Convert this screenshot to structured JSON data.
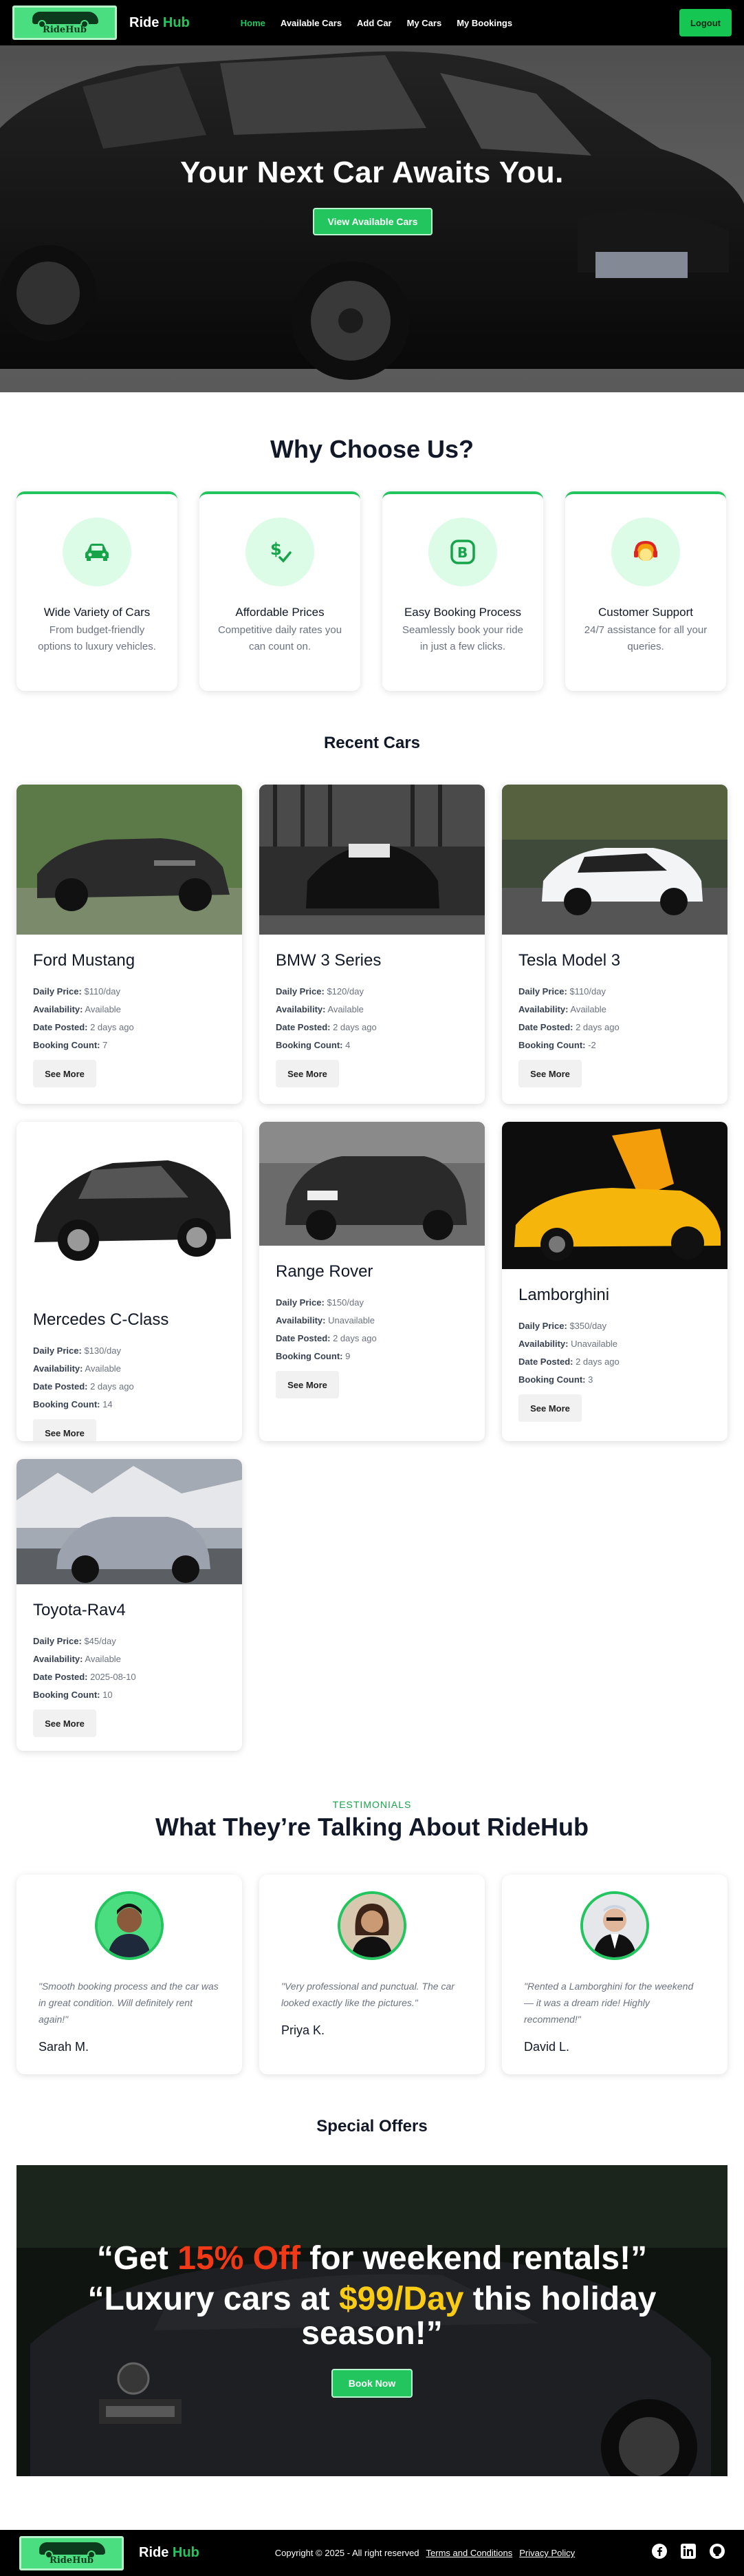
{
  "nav": {
    "logo_text": "RideHub",
    "brand_ride": "Ride",
    "brand_hub": "Hub",
    "links": [
      "Home",
      "Available Cars",
      "Add Car",
      "My Cars",
      "My Bookings"
    ],
    "logout": "Logout"
  },
  "hero": {
    "title": "Your Next Car Awaits You.",
    "button": "View Available Cars"
  },
  "why": {
    "title": "Why Choose Us?",
    "features": [
      {
        "title": "Wide Variety of Cars",
        "desc": "From budget-friendly options to luxury vehicles.",
        "icon": "car-icon"
      },
      {
        "title": "Affordable Prices",
        "desc": "Competitive daily rates you can count on.",
        "icon": "dollar-check-icon"
      },
      {
        "title": "Easy Booking Process",
        "desc": "Seamlessly book your ride in just a few clicks.",
        "icon": "booking-b-icon"
      },
      {
        "title": "Customer Support",
        "desc": "24/7 assistance for all your queries.",
        "icon": "support-headset-icon"
      }
    ]
  },
  "recent": {
    "title": "Recent Cars",
    "labels": {
      "price": "Daily Price:",
      "availability": "Availability:",
      "posted": "Date Posted:",
      "count": "Booking Count:",
      "see_more": "See More"
    },
    "cars": [
      {
        "name": "Ford Mustang",
        "price": "$110/day",
        "availability": "Available",
        "posted": "2 days ago",
        "count": "7"
      },
      {
        "name": "BMW 3 Series",
        "price": "$120/day",
        "availability": "Available",
        "posted": "2 days ago",
        "count": "4"
      },
      {
        "name": "Tesla Model 3",
        "price": "$110/day",
        "availability": "Available",
        "posted": "2 days ago",
        "count": "-2"
      },
      {
        "name": "Mercedes C-Class",
        "price": "$130/day",
        "availability": "Available",
        "posted": "2 days ago",
        "count": "14"
      },
      {
        "name": "Range Rover",
        "price": "$150/day",
        "availability": "Unavailable",
        "posted": "2 days ago",
        "count": "9"
      },
      {
        "name": "Lamborghini",
        "price": "$350/day",
        "availability": "Unavailable",
        "posted": "2 days ago",
        "count": "3"
      },
      {
        "name": "Toyota-Rav4",
        "price": "$45/day",
        "availability": "Available",
        "posted": "2025-08-10",
        "count": "10"
      }
    ]
  },
  "testimonials": {
    "kicker": "TESTIMONIALS",
    "title": "What They’re Talking About RideHub",
    "items": [
      {
        "quote": "\"Smooth booking process and the car was in great condition. Will definitely rent again!\"",
        "name": "Sarah M."
      },
      {
        "quote": "\"Very professional and punctual. The car looked exactly like the pictures.\"",
        "name": "Priya K."
      },
      {
        "quote": "\"Rented a Lamborghini for the weekend — it was a dream ride! Highly recommend!\"",
        "name": "David L."
      }
    ]
  },
  "offers": {
    "title": "Special Offers",
    "line1_a": "“Get ",
    "line1_b": "15% Off",
    "line1_c": " for weekend rentals!”",
    "line2_a": "“Luxury cars at ",
    "line2_b": "$99/Day",
    "line2_c": " this holiday season!”",
    "button": "Book Now"
  },
  "footer": {
    "copyright": "Copyright © 2025 - All right reserved",
    "terms": "Terms and Conditions",
    "privacy": "Privacy Policy"
  },
  "colors": {
    "accent": "#22c55e",
    "nav_bg": "#000000",
    "offer_red": "#f03a17",
    "offer_yellow": "#facc15"
  }
}
